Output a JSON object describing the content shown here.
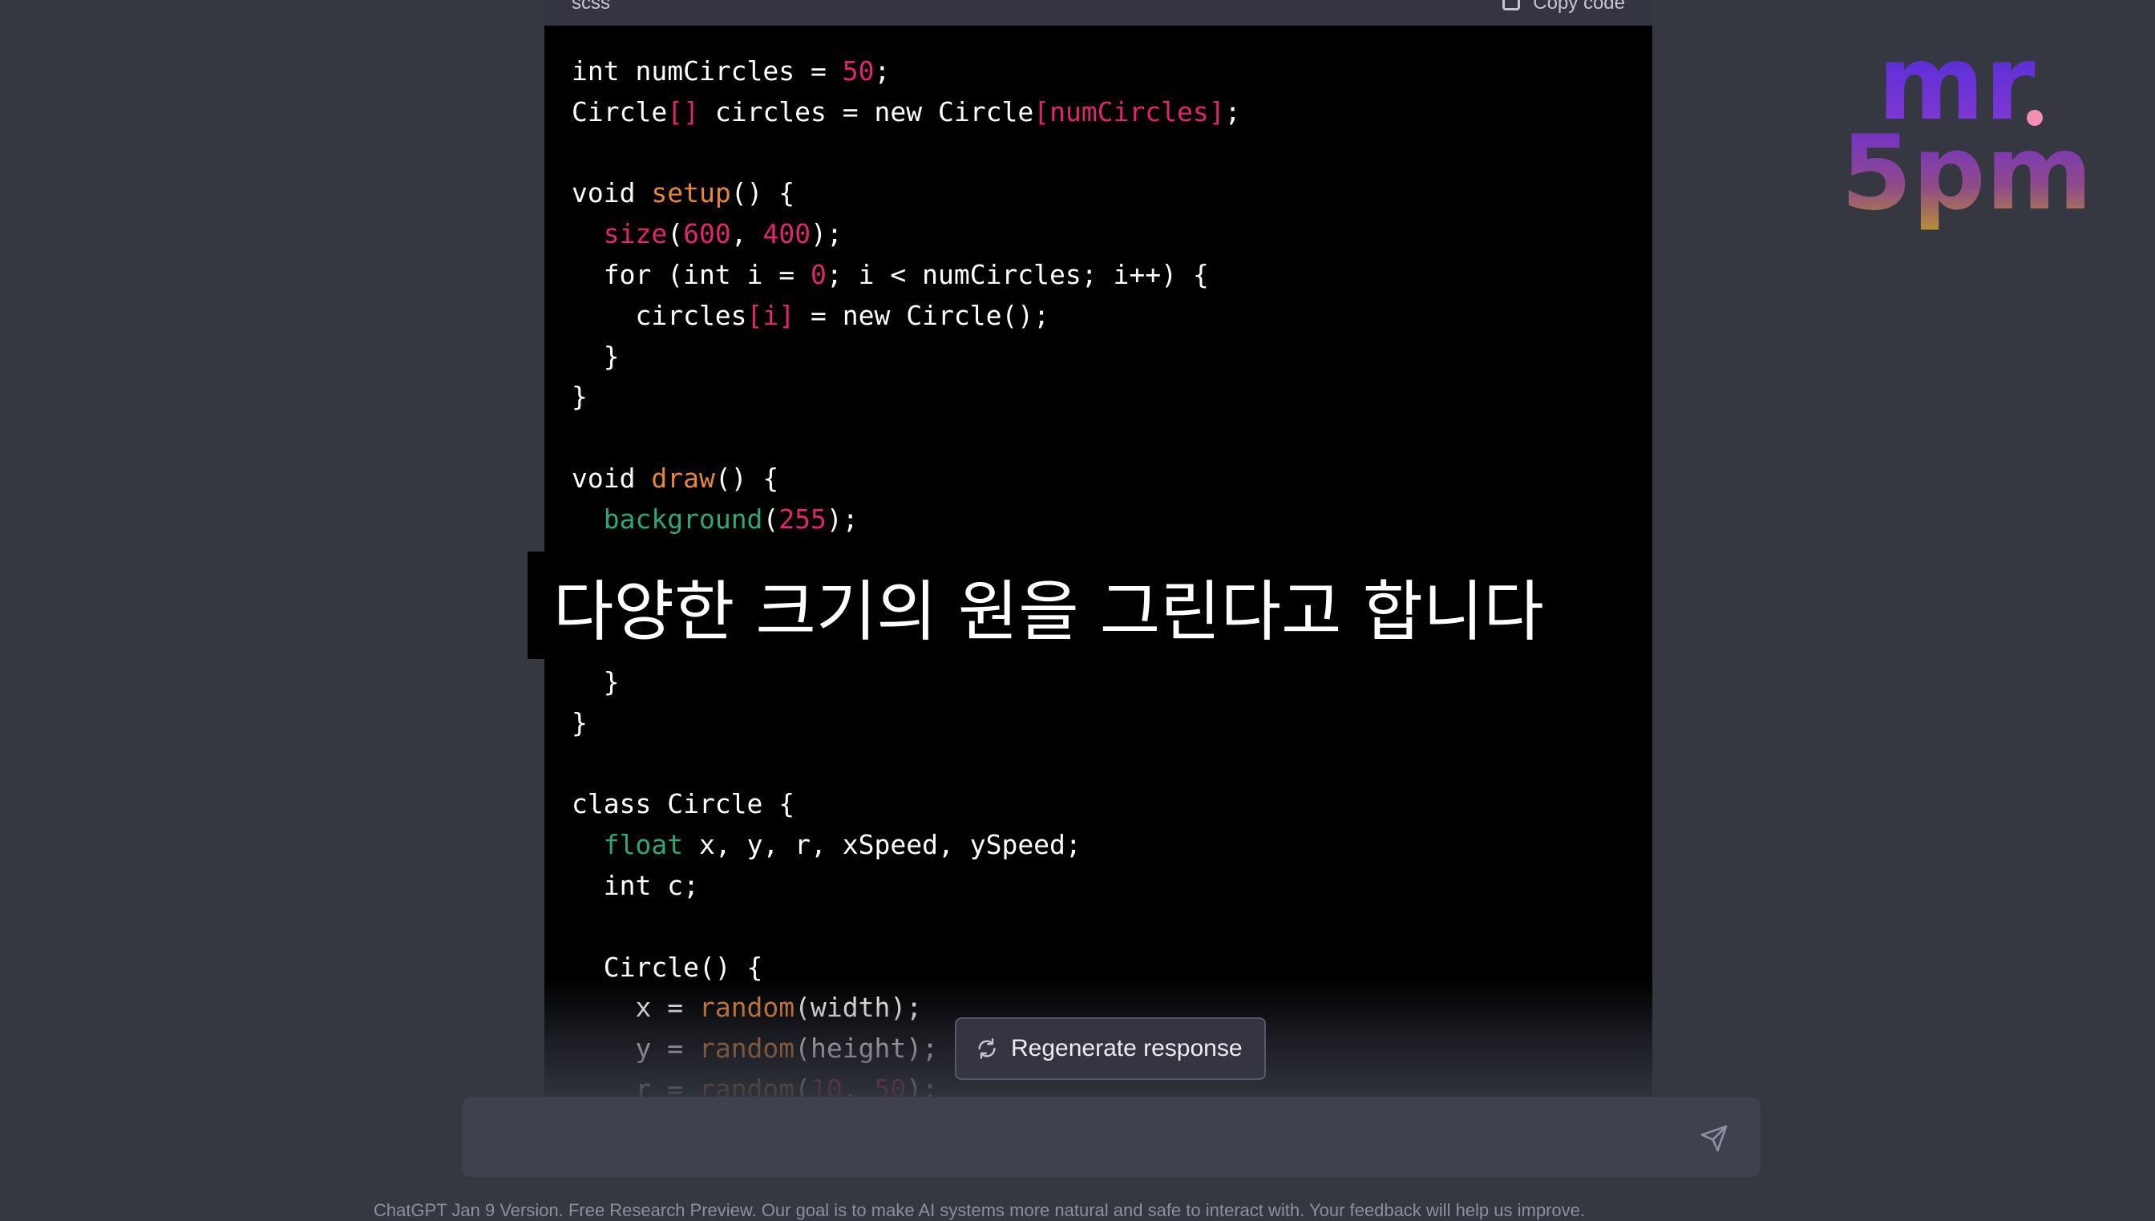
{
  "code_block": {
    "language": "scss",
    "copy_label": "Copy code",
    "lines": [
      [
        {
          "t": "int numCircles = ",
          "c": "p"
        },
        {
          "t": "50",
          "c": "n"
        },
        {
          "t": ";",
          "c": "p"
        }
      ],
      [
        {
          "t": "Circle",
          "c": "p"
        },
        {
          "t": "[]",
          "c": "k"
        },
        {
          "t": " circles = new Circle",
          "c": "p"
        },
        {
          "t": "[numCircles]",
          "c": "k"
        },
        {
          "t": ";",
          "c": "p"
        }
      ],
      [],
      [
        {
          "t": "void ",
          "c": "p"
        },
        {
          "t": "setup",
          "c": "o"
        },
        {
          "t": "() {",
          "c": "p"
        }
      ],
      [
        {
          "t": "  ",
          "c": "p"
        },
        {
          "t": "size",
          "c": "k"
        },
        {
          "t": "(",
          "c": "p"
        },
        {
          "t": "600",
          "c": "n"
        },
        {
          "t": ", ",
          "c": "p"
        },
        {
          "t": "400",
          "c": "n"
        },
        {
          "t": ");",
          "c": "p"
        }
      ],
      [
        {
          "t": "  for (int i = ",
          "c": "p"
        },
        {
          "t": "0",
          "c": "n"
        },
        {
          "t": "; i < numCircles; i++) {",
          "c": "p"
        }
      ],
      [
        {
          "t": "    circles",
          "c": "p"
        },
        {
          "t": "[i]",
          "c": "k"
        },
        {
          "t": " = new Circle();",
          "c": "p"
        }
      ],
      [
        {
          "t": "  }",
          "c": "p"
        }
      ],
      [
        {
          "t": "}",
          "c": "p"
        }
      ],
      [],
      [
        {
          "t": "void ",
          "c": "p"
        },
        {
          "t": "draw",
          "c": "o"
        },
        {
          "t": "() {",
          "c": "p"
        }
      ],
      [
        {
          "t": "  ",
          "c": "p"
        },
        {
          "t": "background",
          "c": "g"
        },
        {
          "t": "(",
          "c": "p"
        },
        {
          "t": "255",
          "c": "n"
        },
        {
          "t": ");",
          "c": "p"
        }
      ],
      [],
      [],
      [],
      [
        {
          "t": "  }",
          "c": "p"
        }
      ],
      [
        {
          "t": "}",
          "c": "p"
        }
      ],
      [],
      [
        {
          "t": "class Circle {",
          "c": "p"
        }
      ],
      [
        {
          "t": "  ",
          "c": "p"
        },
        {
          "t": "float",
          "c": "g"
        },
        {
          "t": " x, y, r, xSpeed, ySpeed;",
          "c": "p"
        }
      ],
      [
        {
          "t": "  int c;",
          "c": "p"
        }
      ],
      [],
      [
        {
          "t": "  Circle() {",
          "c": "p"
        }
      ],
      [
        {
          "t": "    x = ",
          "c": "p"
        },
        {
          "t": "random",
          "c": "o"
        },
        {
          "t": "(width);",
          "c": "p"
        }
      ],
      [
        {
          "t": "    y = ",
          "c": "p"
        },
        {
          "t": "random",
          "c": "o"
        },
        {
          "t": "(height);",
          "c": "p"
        }
      ],
      [
        {
          "t": "    r = ",
          "c": "p"
        },
        {
          "t": "random",
          "c": "o"
        },
        {
          "t": "(",
          "c": "p"
        },
        {
          "t": "10",
          "c": "n"
        },
        {
          "t": ", ",
          "c": "p"
        },
        {
          "t": "50",
          "c": "n"
        },
        {
          "t": ");",
          "c": "p"
        }
      ]
    ]
  },
  "subtitle": "다양한 크기의 원을 그린다고 합니다",
  "regenerate_label": "Regenerate response",
  "chat_input": {
    "placeholder": ""
  },
  "footer_text": "ChatGPT Jan 9 Version. Free Research Preview. Our goal is to make AI systems more natural and safe to interact with. Your feedback will help us improve.",
  "logo": {
    "line1": "mr",
    "line2": "5pm"
  },
  "icons": [
    "copy-icon",
    "refresh-icon",
    "send-icon"
  ],
  "colors": {
    "page_bg": "#353741",
    "code_bg": "#000000",
    "keyword_green": "#2ea67a",
    "function_orange": "#e5873a",
    "number_pink": "#e0256f",
    "logo_purple": "#6b2bd9",
    "logo_dot": "#f48fb1"
  }
}
